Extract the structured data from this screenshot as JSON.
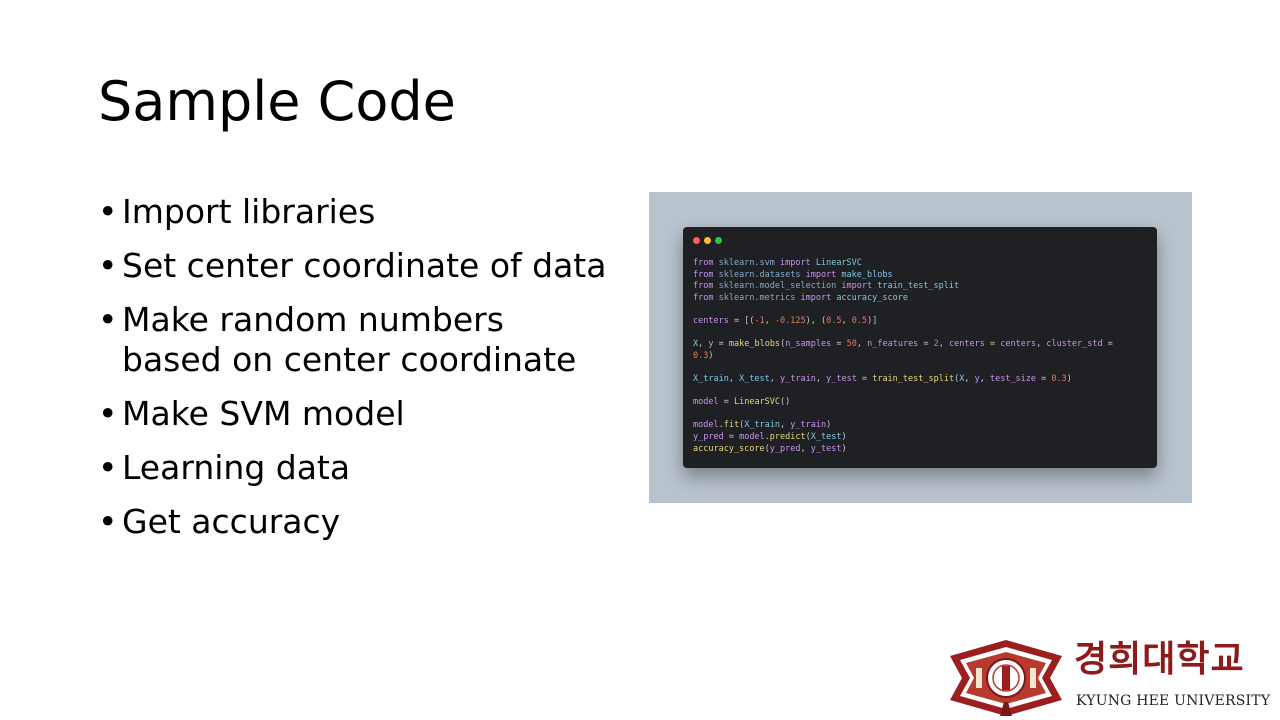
{
  "slide": {
    "title": "Sample Code",
    "bullets": [
      {
        "lines": [
          "Import libraries"
        ]
      },
      {
        "lines": [
          "Set center coordinate of data"
        ]
      },
      {
        "lines": [
          "Make random numbers",
          "based on center coordinate"
        ]
      },
      {
        "lines": [
          "Make SVM model"
        ]
      },
      {
        "lines": [
          "Learning data"
        ]
      },
      {
        "lines": [
          "Get accuracy"
        ]
      }
    ],
    "bullet_char": "•"
  },
  "code_window": {
    "dot_colors": [
      "#ff5f56",
      "#ffbd2e",
      "#27c93f"
    ],
    "lines": [
      [
        [
          "kw",
          "from "
        ],
        [
          "mod",
          "sklearn.svm "
        ],
        [
          "kw",
          "import "
        ],
        [
          "id",
          "LinearSVC"
        ]
      ],
      [
        [
          "kw",
          "from "
        ],
        [
          "mod",
          "sklearn.datasets "
        ],
        [
          "kw",
          "import "
        ],
        [
          "id",
          "make_blobs"
        ]
      ],
      [
        [
          "kw",
          "from "
        ],
        [
          "mod",
          "sklearn.model_selection "
        ],
        [
          "kw",
          "import "
        ],
        [
          "id",
          "train_test_split"
        ]
      ],
      [
        [
          "kw",
          "from "
        ],
        [
          "mod",
          "sklearn.metrics "
        ],
        [
          "kw",
          "import "
        ],
        [
          "id",
          "accuracy_score"
        ]
      ],
      [],
      [
        [
          "kw",
          "centers "
        ],
        [
          "op",
          "= [("
        ],
        [
          "num",
          "-1"
        ],
        [
          "op",
          ", "
        ],
        [
          "num",
          "-0.125"
        ],
        [
          "op",
          "), ("
        ],
        [
          "num",
          "0.5"
        ],
        [
          "op",
          ", "
        ],
        [
          "num",
          "0.5"
        ],
        [
          "op",
          ")]"
        ]
      ],
      [],
      [
        [
          "id",
          "X"
        ],
        [
          "op",
          ", "
        ],
        [
          "kw",
          "y "
        ],
        [
          "op",
          "= "
        ],
        [
          "fn",
          "make_blobs"
        ],
        [
          "op",
          "("
        ],
        [
          "kw",
          "n_samples "
        ],
        [
          "op",
          "= "
        ],
        [
          "num",
          "50"
        ],
        [
          "op",
          ", "
        ],
        [
          "kw",
          "n_features "
        ],
        [
          "op",
          "= "
        ],
        [
          "num",
          "2"
        ],
        [
          "op",
          ", "
        ],
        [
          "kw",
          "centers "
        ],
        [
          "op",
          "= "
        ],
        [
          "kw",
          "centers"
        ],
        [
          "op",
          ", "
        ],
        [
          "kw",
          "cluster_std "
        ],
        [
          "op",
          "="
        ]
      ],
      [
        [
          "num",
          "0.3"
        ],
        [
          "op",
          ")"
        ]
      ],
      [],
      [
        [
          "id",
          "X_train"
        ],
        [
          "op",
          ", "
        ],
        [
          "id",
          "X_test"
        ],
        [
          "op",
          ", "
        ],
        [
          "kw",
          "y_train"
        ],
        [
          "op",
          ", "
        ],
        [
          "kw",
          "y_test "
        ],
        [
          "op",
          "= "
        ],
        [
          "fn",
          "train_test_split"
        ],
        [
          "op",
          "("
        ],
        [
          "id",
          "X"
        ],
        [
          "op",
          ", "
        ],
        [
          "kw",
          "y"
        ],
        [
          "op",
          ", "
        ],
        [
          "kw",
          "test_size "
        ],
        [
          "op",
          "= "
        ],
        [
          "num",
          "0.3"
        ],
        [
          "op",
          ")"
        ]
      ],
      [],
      [
        [
          "kw",
          "model "
        ],
        [
          "op",
          "= "
        ],
        [
          "fn",
          "LinearSVC"
        ],
        [
          "op",
          "()"
        ]
      ],
      [],
      [
        [
          "kw",
          "model"
        ],
        [
          "op",
          "."
        ],
        [
          "fn",
          "fit"
        ],
        [
          "op",
          "("
        ],
        [
          "id",
          "X_train"
        ],
        [
          "op",
          ", "
        ],
        [
          "kw",
          "y_train"
        ],
        [
          "op",
          ")"
        ]
      ],
      [
        [
          "kw",
          "y_pred "
        ],
        [
          "op",
          "= "
        ],
        [
          "kw",
          "model"
        ],
        [
          "op",
          "."
        ],
        [
          "fn",
          "predict"
        ],
        [
          "op",
          "("
        ],
        [
          "id",
          "X_test"
        ],
        [
          "op",
          ")"
        ]
      ],
      [
        [
          "fn",
          "accuracy_score"
        ],
        [
          "op",
          "("
        ],
        [
          "kw",
          "y_pred"
        ],
        [
          "op",
          ", "
        ],
        [
          "kw",
          "y_test"
        ],
        [
          "op",
          ")"
        ]
      ]
    ]
  },
  "logo": {
    "korean_name": "경희대학교",
    "english_name": "KYUNG HEE UNIVERSITY",
    "primary_color": "#8e1b1b"
  }
}
